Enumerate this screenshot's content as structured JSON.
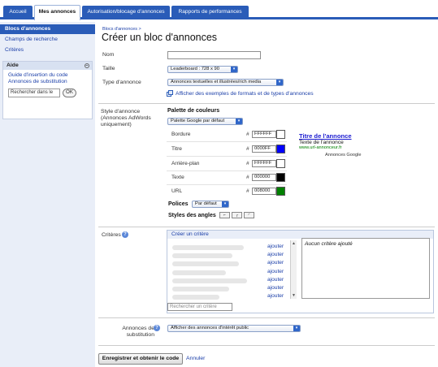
{
  "tabs": [
    {
      "label": "Accueil"
    },
    {
      "label": "Mes annonces"
    },
    {
      "label": "Autorisation/blocage d'annonces"
    },
    {
      "label": "Rapports de performances"
    }
  ],
  "sidebar": {
    "items": [
      {
        "label": "Blocs d'annonces"
      },
      {
        "label": "Champs de recherche"
      },
      {
        "label": "Critères"
      }
    ],
    "help": {
      "title": "Aide",
      "links": [
        "Guide d'insertion du code",
        "Annonces de substitution"
      ],
      "search_value": "Rechercher dans le",
      "ok_label": "OK"
    }
  },
  "main": {
    "breadcrumb": "Blocs d'annonces >",
    "title": "Créer un bloc d'annonces",
    "nom_label": "Nom",
    "nom_value": "",
    "taille_label": "Taille",
    "taille_value": "Leaderboard : 728 x 90",
    "type_label": "Type d'annonce",
    "type_value": "Annonces textuelles et illustrées/rich media",
    "examples_link": "Afficher des exemples de formats et de types d'annonces",
    "style_label": "Style d'annonce (Annonces AdWords uniquement)",
    "palette_heading": "Palette de couleurs",
    "palette_value": "Palette Google par défaut",
    "colors": [
      {
        "label": "Bordure",
        "hex": "FFFFFF",
        "color": "#FFFFFF"
      },
      {
        "label": "Titre",
        "hex": "0000FF",
        "color": "#0000FF"
      },
      {
        "label": "Arrière-plan",
        "hex": "FFFFFF",
        "color": "#FFFFFF"
      },
      {
        "label": "Texte",
        "hex": "000000",
        "color": "#000000"
      },
      {
        "label": "URL",
        "hex": "008000",
        "color": "#008000"
      }
    ],
    "hash": "#",
    "polices_label": "Polices",
    "polices_value": "Par défaut",
    "angles_label": "Styles des angles",
    "preview": {
      "title": "Titre de l'annonce",
      "text": "Texte de l'annonce",
      "url": "www.url-annonceur.fr",
      "attribution": "Annonces Google"
    },
    "criteres_label": "Critères",
    "create_link": "Créer un critère",
    "ajouter_label": "ajouter",
    "no_criteria": "Aucun critère ajouté",
    "search_placeholder": "Rechercher un critère",
    "substitution_label": "Annonces de substitution",
    "substitution_value": "Afficher des annonces d'intérêt public",
    "save_label": "Enregistrer et obtenir le code",
    "cancel_label": "Annuler"
  }
}
